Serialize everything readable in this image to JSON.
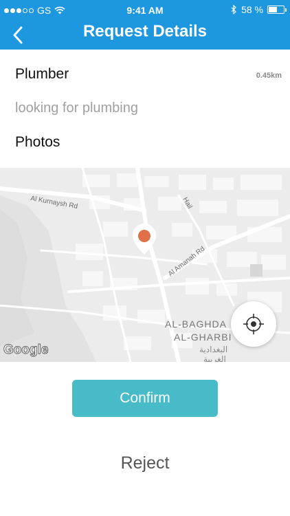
{
  "status_bar": {
    "carrier": "GS",
    "time": "9:41 AM",
    "battery_text": "58 %",
    "battery_level": 0.58
  },
  "nav": {
    "title": "Request Details",
    "back_icon": "chevron-left-icon"
  },
  "request": {
    "service": "Plumber",
    "distance": "0.45km",
    "description": "looking for plumbing",
    "photos_label": "Photos"
  },
  "map": {
    "labels": {
      "road1": "Al Kurnaysh Rd",
      "road2": "Hail",
      "road3": "Al Amanah Rd",
      "district1": "AL-BAGHDA",
      "district2": "AL-GHARBI",
      "district_ar1": "البغدادية",
      "district_ar2": "الغربية",
      "brand": "Google"
    },
    "pin_color": "#e07048"
  },
  "actions": {
    "confirm_label": "Confirm",
    "reject_label": "Reject"
  },
  "colors": {
    "primary": "#1d97e0",
    "confirm": "#47bcc8"
  }
}
